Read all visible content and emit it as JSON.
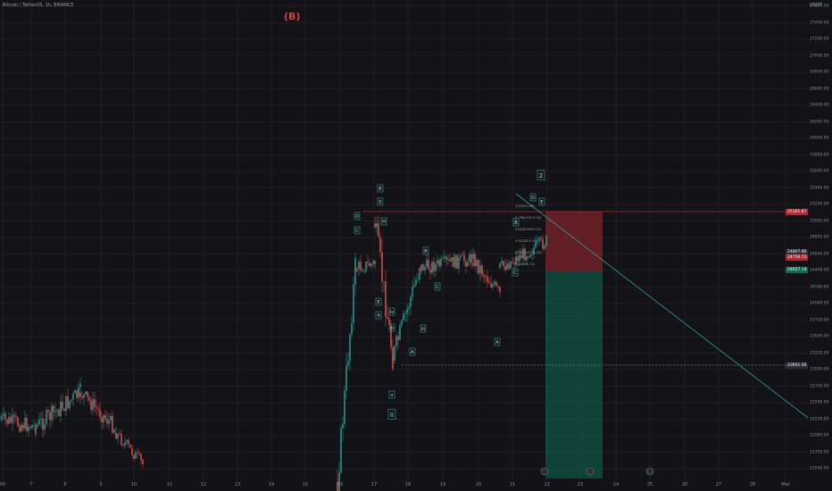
{
  "header": {
    "symbol_text": "Bitcoin / TetherUS, 1h, BINANCE",
    "wave_label": "(B)",
    "currency": "USDT"
  },
  "price_axis": {
    "ticks": [
      "27600.00",
      "27400.00",
      "27200.00",
      "27000.00",
      "26800.00",
      "26600.00",
      "26400.00",
      "26200.00",
      "26000.00",
      "25800.00",
      "25600.00",
      "25400.00",
      "25200.00",
      "25000.00",
      "24800.00",
      "24600.00",
      "24400.00",
      "24200.00",
      "24000.00",
      "23750.00",
      "23500.00",
      "23250.00",
      "23000.00",
      "22750.00",
      "22500.00",
      "22250.00",
      "22000.00",
      "21750.00",
      "21500.00"
    ],
    "price_tags": [
      {
        "text": "25181.87",
        "color": "#b22833"
      },
      {
        "text": "24807.80",
        "color": "#2a2e39"
      },
      {
        "text": "24756.73",
        "color": "#b22833"
      },
      {
        "text": "24657.14",
        "color": "#0c6b52"
      },
      {
        "text": "23601.00",
        "color": "#2a2e39"
      }
    ]
  },
  "time_axis": {
    "ticks": [
      "00",
      "7",
      "8",
      "9",
      "10",
      "11",
      "12",
      "13",
      "14",
      "15",
      "16",
      "17",
      "18",
      "19",
      "20",
      "21",
      "22",
      "23",
      "24",
      "25",
      "26",
      "27",
      "28",
      "Mar"
    ]
  },
  "wave_labels": [
    {
      "text": "E"
    },
    {
      "text": "S"
    },
    {
      "text": "D"
    },
    {
      "text": "C"
    },
    {
      "text": "H"
    },
    {
      "text": "E"
    },
    {
      "text": "4"
    },
    {
      "text": "iv"
    },
    {
      "text": "iii"
    },
    {
      "text": "v"
    },
    {
      "text": "ii"
    },
    {
      "text": "B"
    },
    {
      "text": "A"
    },
    {
      "text": "2"
    },
    {
      "text": "D"
    },
    {
      "text": "E"
    },
    {
      "text": "B"
    },
    {
      "text": "C"
    },
    {
      "text": "iii"
    },
    {
      "text": "A"
    },
    {
      "text": "C"
    }
  ],
  "fib_levels": [
    "1(25253.46)",
    "0.786(25073.32)",
    "0.618(24901.07)",
    "0.5(24812.99)",
    "0.382(24725.43)",
    "0(24433.72)"
  ],
  "colors": {
    "background": "#131317",
    "bull": "#26a69a",
    "bear": "#ef5350",
    "short_zone": "#b22833",
    "target_zone": "#0c6b52",
    "label_border": "#26a69a"
  }
}
